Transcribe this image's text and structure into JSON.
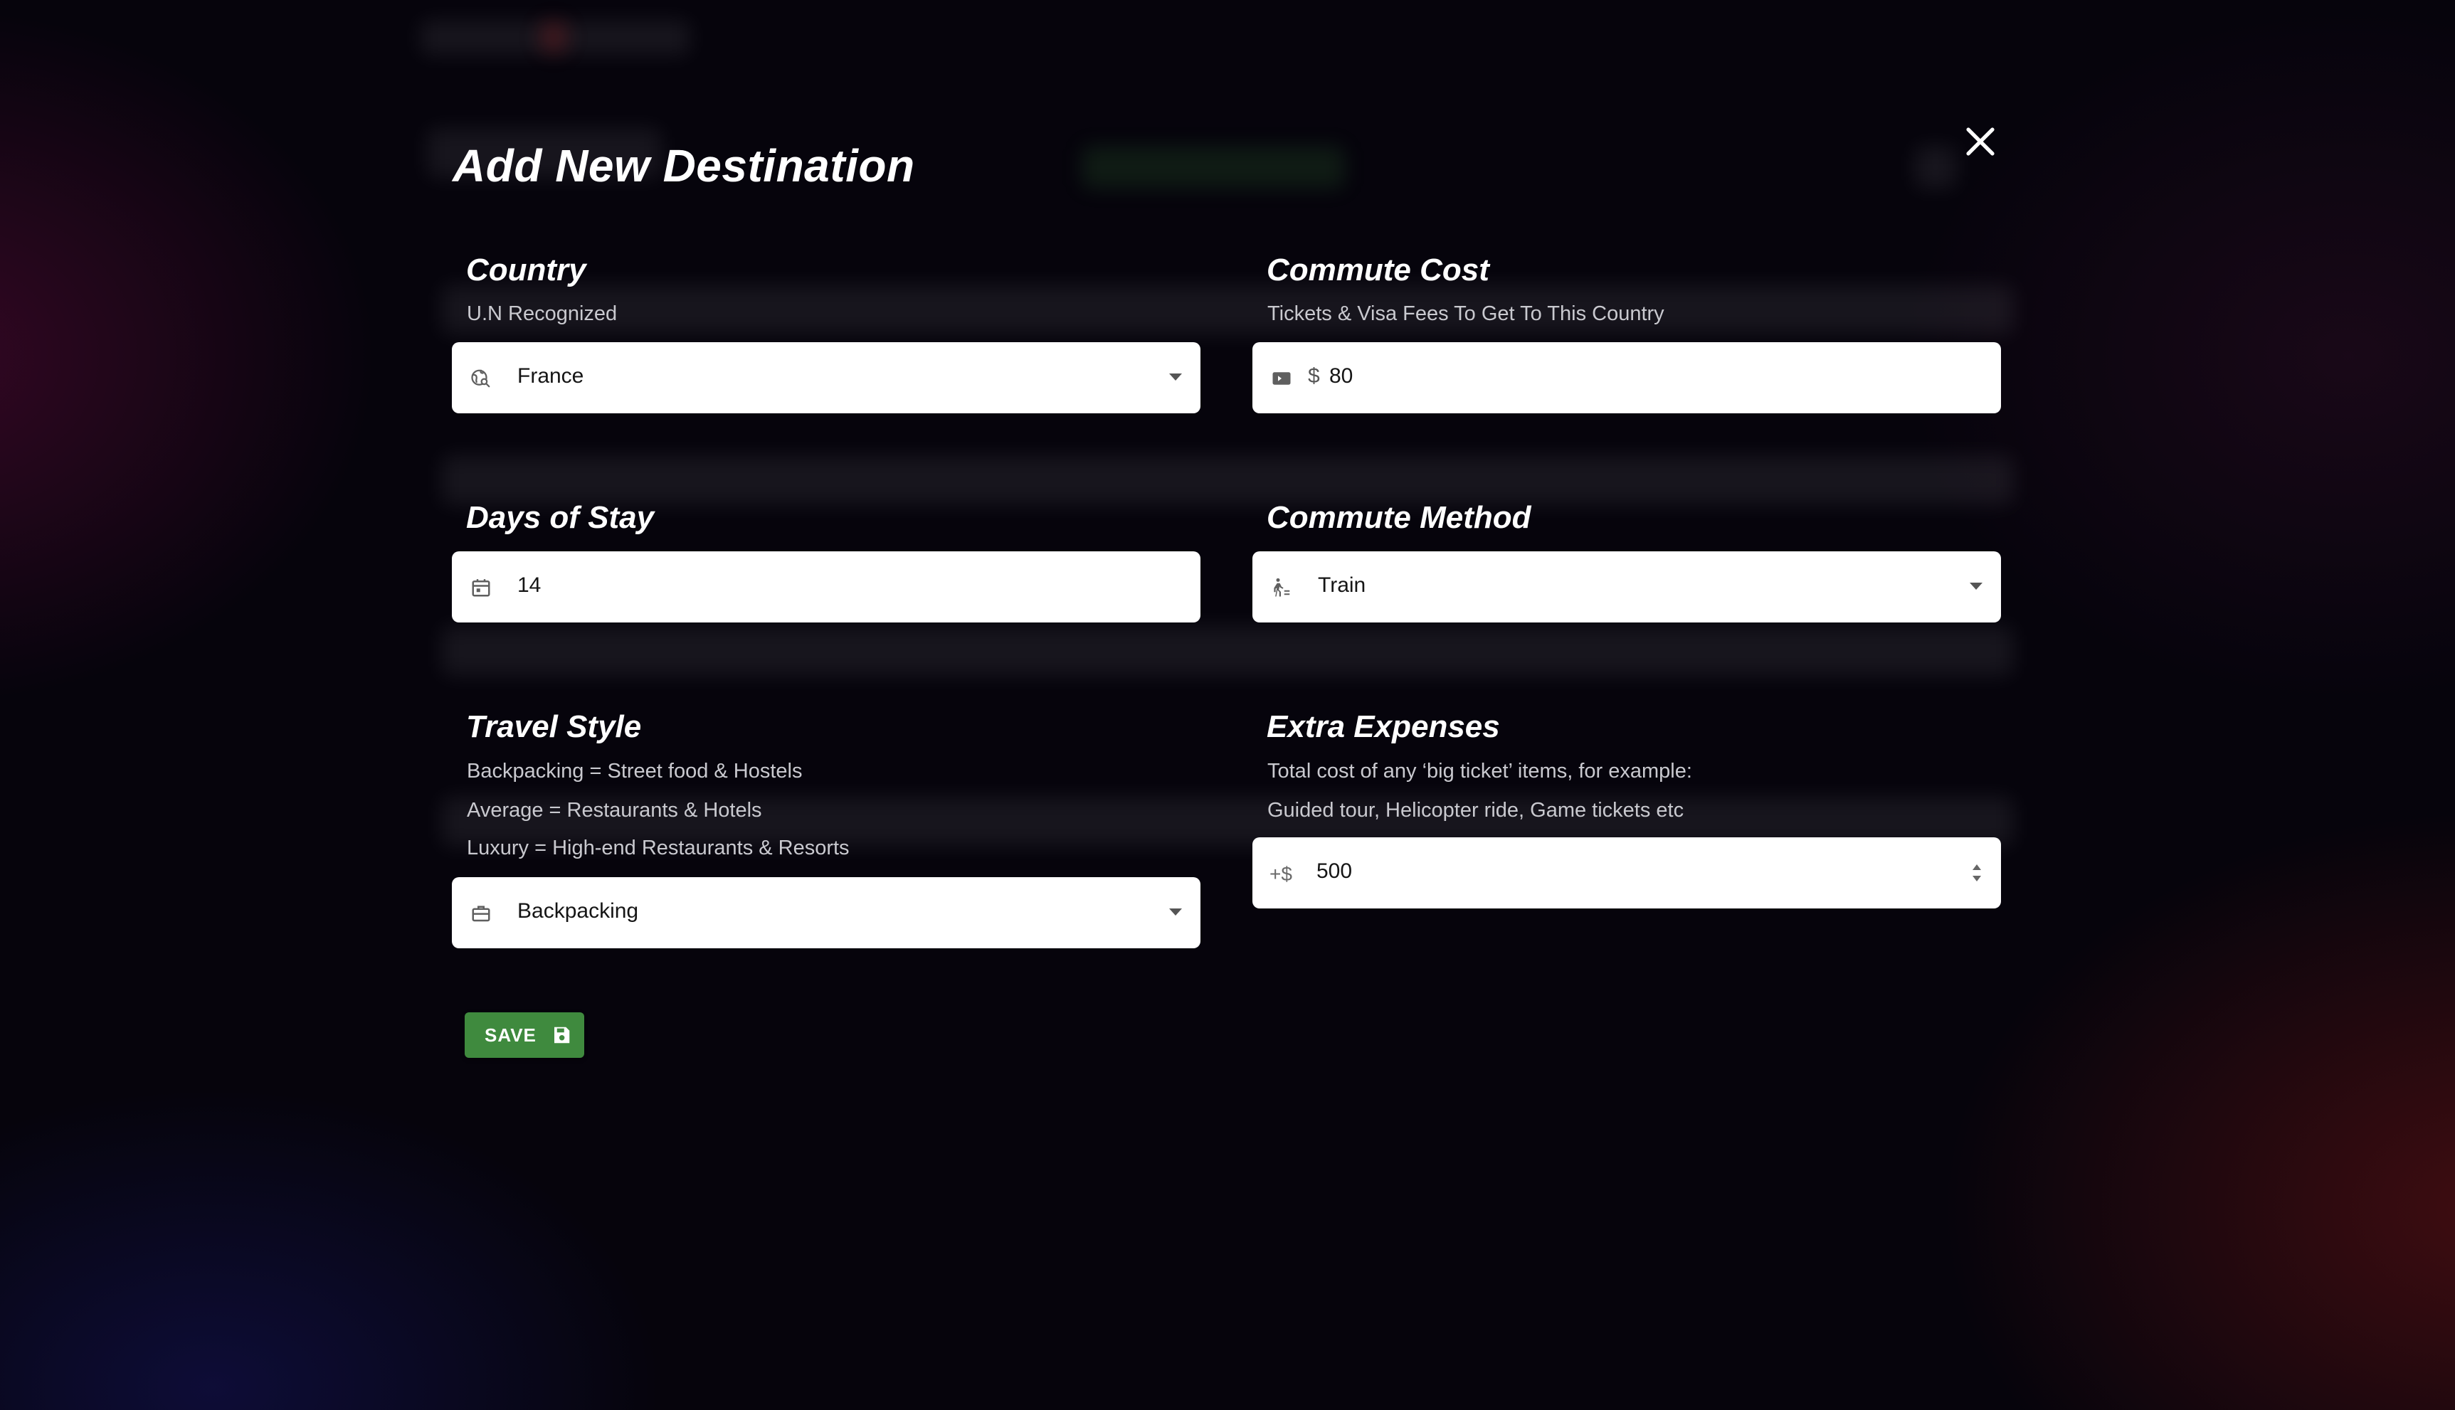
{
  "modal": {
    "title": "Add New Destination",
    "close_icon": "close-icon"
  },
  "country": {
    "label": "Country",
    "hint": "U.N Recognized",
    "value": "France",
    "icon": "globe-search-icon"
  },
  "commute_cost": {
    "label": "Commute Cost",
    "hint": "Tickets & Visa Fees To Get To This Country",
    "currency_prefix": "$",
    "value": "80",
    "icon": "ticket-icon"
  },
  "days_of_stay": {
    "label": "Days of Stay",
    "value": "14",
    "icon": "calendar-icon"
  },
  "commute_method": {
    "label": "Commute Method",
    "value": "Train",
    "icon": "walk-icon"
  },
  "travel_style": {
    "label": "Travel Style",
    "hints": [
      "Backpacking = Street food & Hostels",
      "Average = Restaurants & Hotels",
      "Luxury = High-end Restaurants & Resorts"
    ],
    "value": "Backpacking",
    "icon": "briefcase-icon"
  },
  "extra_expenses": {
    "label": "Extra Expenses",
    "hints": [
      "Total cost of any ‘big ticket’ items, for example:",
      "Guided tour, Helicopter ride, Game tickets etc"
    ],
    "prefix": "+$",
    "value": "500"
  },
  "save_button": {
    "label": "SAVE",
    "icon": "save-icon",
    "color": "#3f8a3e"
  }
}
